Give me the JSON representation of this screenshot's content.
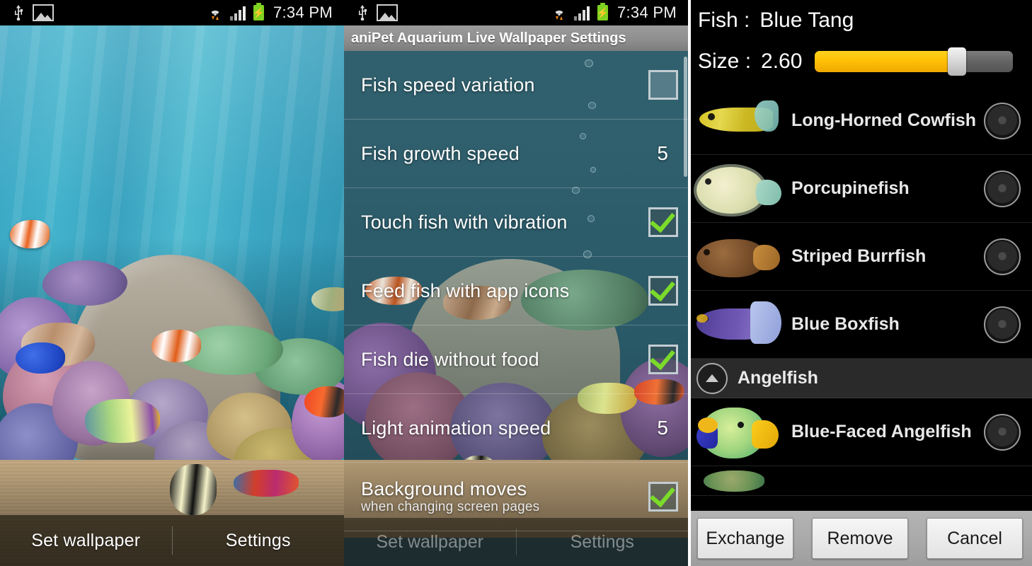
{
  "statusbar": {
    "icons": [
      "usb-icon",
      "screenshot-icon",
      "wifi-icon",
      "signal-icon",
      "battery-charging-icon"
    ],
    "time": "7:34 PM"
  },
  "home": {
    "wallpaper_name": "aniPet Aquarium Live Wallpaper",
    "navbar": {
      "set_wallpaper": "Set wallpaper",
      "settings": "Settings"
    },
    "fish_in_scene": [
      "Clownfish",
      "Lionfish",
      "Blue Tang",
      "Clownfish",
      "Moorish Idol",
      "Flame Wrasse",
      "Purple Firefish",
      "Butterflyfish"
    ]
  },
  "settings": {
    "title": "aniPet Aquarium Live Wallpaper Settings",
    "items": [
      {
        "label": "Fish speed variation",
        "type": "checkbox",
        "checked": false
      },
      {
        "label": "Fish growth speed",
        "type": "value",
        "value": "5"
      },
      {
        "label": "Touch fish with vibration",
        "type": "checkbox",
        "checked": true
      },
      {
        "label": "Feed fish with app icons",
        "type": "checkbox",
        "checked": true
      },
      {
        "label": "Fish die without food",
        "type": "checkbox",
        "checked": true
      },
      {
        "label": "Light animation speed",
        "type": "value",
        "value": "5"
      },
      {
        "label": "Background moves",
        "sub": "when changing screen pages",
        "type": "checkbox",
        "checked": true
      }
    ],
    "navbar": {
      "set_wallpaper": "Set wallpaper",
      "settings": "Settings"
    }
  },
  "fish_picker": {
    "header": {
      "fish_label": "Fish :",
      "fish_value": "Blue Tang",
      "size_label": "Size :",
      "size_value": "2.60",
      "size_percent": 71,
      "slider_fill_color": "#ffc107",
      "slider_track_color": "#6e6e6e"
    },
    "rows": [
      {
        "kind": "fish",
        "name": "Long-Horned Cowfish",
        "selected": false
      },
      {
        "kind": "fish",
        "name": "Porcupinefish",
        "selected": false
      },
      {
        "kind": "fish",
        "name": "Striped Burrfish",
        "selected": false
      },
      {
        "kind": "fish",
        "name": "Blue Boxfish",
        "selected": false
      },
      {
        "kind": "group",
        "name": "Angelfish",
        "expanded": true
      },
      {
        "kind": "fish",
        "name": "Blue-Faced Angelfish",
        "selected": false
      }
    ],
    "buttons": {
      "exchange": "Exchange",
      "remove": "Remove",
      "cancel": "Cancel"
    }
  }
}
